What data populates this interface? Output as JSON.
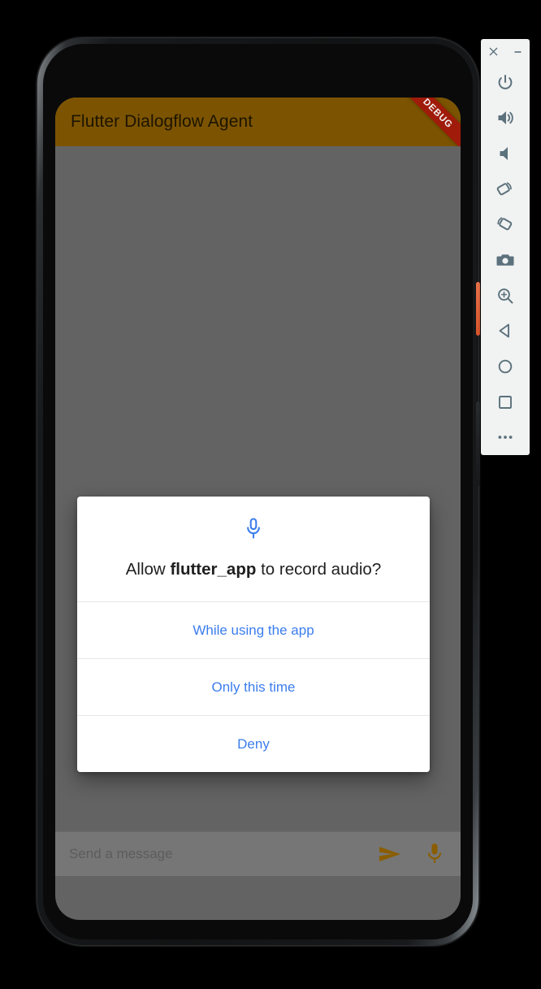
{
  "app": {
    "title": "Flutter Dialogflow Agent",
    "debug_banner": "DEBUG",
    "appbar_color": "#7c5401",
    "body_color": "#636363",
    "accent_color": "#8a5e00"
  },
  "message_bar": {
    "placeholder": "Send a message",
    "value": "",
    "send_icon": "send-icon",
    "mic_icon": "microphone-icon"
  },
  "permission_dialog": {
    "icon": "microphone-icon",
    "icon_color": "#3b7ded",
    "message_prefix": "Allow ",
    "app_name": "flutter_app",
    "message_suffix": " to record audio?",
    "options": [
      {
        "label": "While using the app",
        "name": "while-using-the-app"
      },
      {
        "label": "Only this time",
        "name": "only-this-time"
      },
      {
        "label": "Deny",
        "name": "deny"
      }
    ],
    "option_color": "#3b7ded"
  },
  "emulator_toolbar": {
    "window_controls": [
      {
        "name": "close-icon",
        "glyph": "×"
      },
      {
        "name": "minimize-icon",
        "glyph": "−"
      }
    ],
    "buttons": [
      {
        "name": "power-button",
        "label": "Power"
      },
      {
        "name": "volume-up-button",
        "label": "Volume Up"
      },
      {
        "name": "volume-down-button",
        "label": "Volume Down"
      },
      {
        "name": "rotate-left-button",
        "label": "Rotate Left"
      },
      {
        "name": "rotate-right-button",
        "label": "Rotate Right"
      },
      {
        "name": "screenshot-button",
        "label": "Take Screenshot"
      },
      {
        "name": "zoom-button",
        "label": "Enter Zoom Mode"
      },
      {
        "name": "back-button",
        "label": "Back"
      },
      {
        "name": "home-button",
        "label": "Home"
      },
      {
        "name": "overview-button",
        "label": "Overview"
      },
      {
        "name": "more-button",
        "label": "More"
      }
    ],
    "icon_color": "#5b717c"
  }
}
